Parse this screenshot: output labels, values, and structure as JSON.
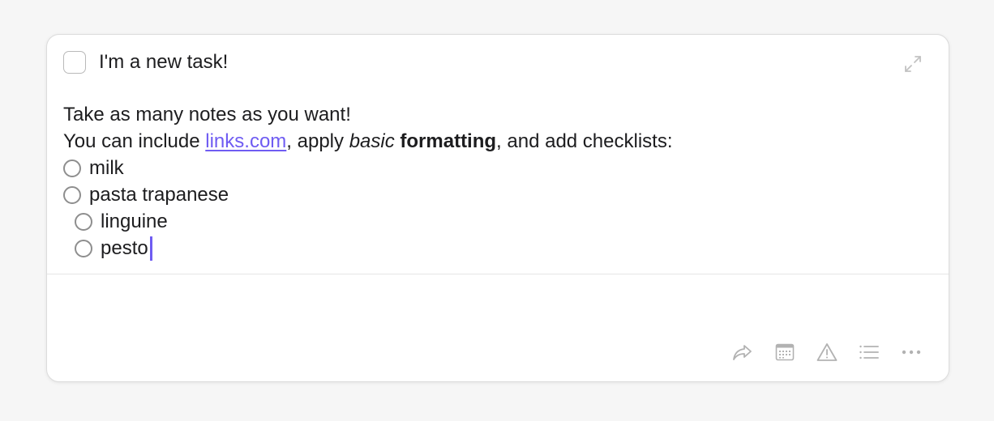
{
  "task": {
    "title": "I'm a new task!",
    "completed": false
  },
  "notes": {
    "line1": "Take as many notes as you want!",
    "line2_prefix": "You can include ",
    "link_text": "links.com",
    "line2_mid": ", apply ",
    "italic_text": "basic",
    "bold_text": "formatting",
    "line2_suffix": ", and add checklists:",
    "checklist": [
      {
        "label": "milk",
        "checked": false,
        "level": 0
      },
      {
        "label": "pasta trapanese",
        "checked": false,
        "level": 0
      },
      {
        "label": "linguine",
        "checked": false,
        "level": 1
      },
      {
        "label": "pesto",
        "checked": false,
        "level": 1
      }
    ]
  },
  "icons": {
    "expand": "expand-icon",
    "toolbar": [
      "share-icon",
      "calendar-icon",
      "warning-icon",
      "list-icon",
      "more-icon"
    ]
  },
  "colors": {
    "accent": "#6f5cf2",
    "icon": "#b2b2b2"
  }
}
